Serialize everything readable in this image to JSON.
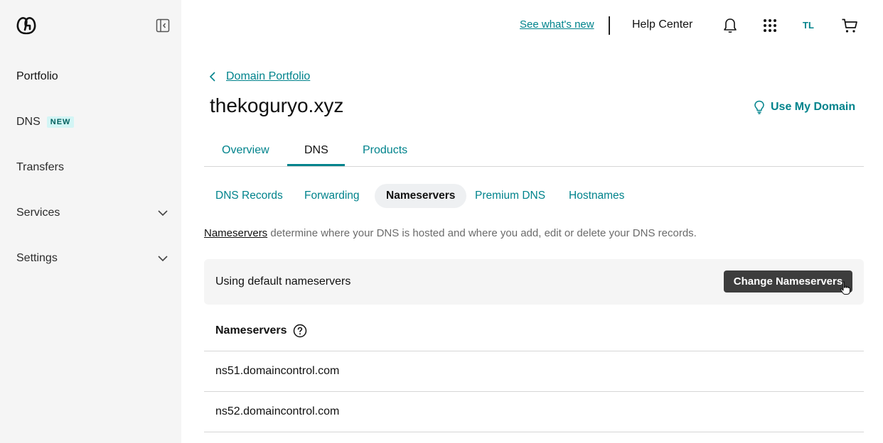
{
  "sidebar": {
    "items": [
      {
        "label": "Portfolio"
      },
      {
        "label": "DNS",
        "badge": "NEW"
      },
      {
        "label": "Transfers"
      },
      {
        "label": "Services"
      },
      {
        "label": "Settings"
      }
    ]
  },
  "topbar": {
    "whats_new": "See what's new",
    "help": "Help Center",
    "avatar": "TL",
    "icons": [
      "bell-icon",
      "apps-grid-icon",
      "cart-icon"
    ]
  },
  "breadcrumb": {
    "label": "Domain Portfolio"
  },
  "page": {
    "title": "thekoguryo.xyz",
    "use_domain": "Use My Domain"
  },
  "tabs": [
    {
      "label": "Overview"
    },
    {
      "label": "DNS",
      "active": true
    },
    {
      "label": "Products"
    }
  ],
  "subtabs": [
    {
      "label": "DNS Records"
    },
    {
      "label": "Forwarding"
    },
    {
      "label": "Nameservers",
      "active": true
    },
    {
      "label": "Premium DNS"
    },
    {
      "label": "Hostnames"
    }
  ],
  "description": {
    "link": "Nameservers",
    "text": " determine where your DNS is hosted and where you add, edit or delete your DNS records."
  },
  "panel": {
    "status": "Using default nameservers",
    "button": "Change Nameservers"
  },
  "nameservers": {
    "header": "Nameservers",
    "rows": [
      "ns51.domaincontrol.com",
      "ns52.domaincontrol.com"
    ]
  },
  "colors": {
    "accent": "#00838c",
    "sidebar_bg": "#f5f5f5",
    "badge_bg": "#d3f5f5",
    "button_bg": "#3d3d3d"
  }
}
